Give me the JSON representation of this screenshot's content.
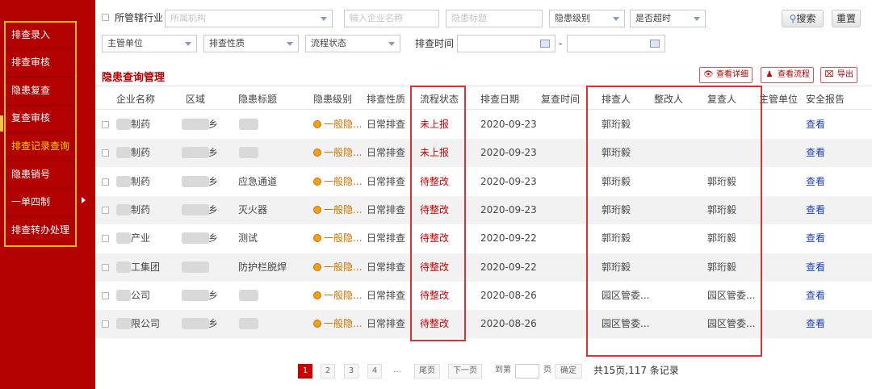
{
  "sidebar": {
    "items": [
      {
        "label": "排查录入",
        "active": false
      },
      {
        "label": "排查审核",
        "active": false
      },
      {
        "label": "隐患复查",
        "active": false
      },
      {
        "label": "复查审核",
        "active": false
      },
      {
        "label": "排查记录查询",
        "active": true
      },
      {
        "label": "隐患销号",
        "active": false
      },
      {
        "label": "一单四制",
        "active": false
      },
      {
        "label": "排查转办处理",
        "active": false
      }
    ]
  },
  "filters": {
    "industry_label": "所管辖行业",
    "org_placeholder": "所属机构",
    "company_placeholder": "输入企业名称",
    "hazard_title_placeholder": "隐患标题",
    "hazard_level": "隐患级别",
    "overtime": "是否超时",
    "dept": "主管单位",
    "nature": "排查性质",
    "flow_state": "流程状态",
    "time_label": "排查时间",
    "date_sep": "-",
    "search": "搜索",
    "reset": "重置"
  },
  "page": {
    "title": "隐患查询管理",
    "view_detail": "查看详细",
    "view_flow": "查看流程",
    "export": "导出"
  },
  "table": {
    "headers": [
      "企业名称",
      "区域",
      "隐患标题",
      "隐患级别",
      "排查性质",
      "流程状态",
      "排查日期",
      "复查时间",
      "排查人",
      "整改人",
      "复查人",
      "主管单位",
      "安全报告"
    ],
    "rows": [
      {
        "company": "制药",
        "area": "乡",
        "title": "",
        "level": "一般隐...",
        "nature": "日常排查",
        "state": "未上报",
        "date": "2020-09-23",
        "recheck_time": "",
        "checker": "郭珩毅",
        "rectifier": "",
        "reviewer": "",
        "dept": "",
        "report": "查看"
      },
      {
        "company": "制药",
        "area": "乡",
        "title": "",
        "level": "一般隐...",
        "nature": "日常排查",
        "state": "未上报",
        "date": "2020-09-23",
        "recheck_time": "",
        "checker": "郭珩毅",
        "rectifier": "",
        "reviewer": "",
        "dept": "",
        "report": "查看"
      },
      {
        "company": "制药",
        "area": "乡",
        "title": "应急通道",
        "level": "一般隐...",
        "nature": "日常排查",
        "state": "待整改",
        "date": "2020-09-23",
        "recheck_time": "",
        "checker": "郭珩毅",
        "rectifier": "",
        "reviewer": "郭珩毅",
        "dept": "",
        "report": "查看"
      },
      {
        "company": "制药",
        "area": "乡",
        "title": "灭火器",
        "level": "一般隐...",
        "nature": "日常排查",
        "state": "待整改",
        "date": "2020-09-23",
        "recheck_time": "",
        "checker": "郭珩毅",
        "rectifier": "",
        "reviewer": "郭珩毅",
        "dept": "",
        "report": "查看"
      },
      {
        "company": "产业",
        "area": "乡",
        "title": "测试",
        "level": "一般隐...",
        "nature": "日常排查",
        "state": "待整改",
        "date": "2020-09-22",
        "recheck_time": "",
        "checker": "郭珩毅",
        "rectifier": "",
        "reviewer": "郭珩毅",
        "dept": "",
        "report": "查看"
      },
      {
        "company": "工集团",
        "area": "",
        "title": "防护栏脱焊",
        "level": "一般隐...",
        "nature": "日常排查",
        "state": "待整改",
        "date": "2020-09-22",
        "recheck_time": "",
        "checker": "郭珩毅",
        "rectifier": "",
        "reviewer": "郭珩毅",
        "dept": "",
        "report": "查看"
      },
      {
        "company": "公司",
        "area": "乡",
        "title": "",
        "level": "一般隐...",
        "nature": "日常排查",
        "state": "待整改",
        "date": "2020-08-26",
        "recheck_time": "",
        "checker": "园区管委...",
        "rectifier": "",
        "reviewer": "园区管委...",
        "dept": "",
        "report": "查看"
      },
      {
        "company": "限公司",
        "area": "乡",
        "title": "",
        "level": "一般隐...",
        "nature": "日常排查",
        "state": "待整改",
        "date": "2020-08-26",
        "recheck_time": "",
        "checker": "园区管委...",
        "rectifier": "",
        "reviewer": "园区管委...",
        "dept": "",
        "report": "查看"
      }
    ]
  },
  "pagination": {
    "pages": [
      "1",
      "2",
      "3",
      "4"
    ],
    "ellipsis": "...",
    "last": "尾页",
    "next": "下一页",
    "goto": "到第",
    "page_unit": "页",
    "confirm": "确定",
    "total": "共15页,117 条记录"
  },
  "colors": {
    "sidebar": "#b30000",
    "active_menu": "#ffd200",
    "accent": "#d40000",
    "link": "#1a3fb5"
  }
}
